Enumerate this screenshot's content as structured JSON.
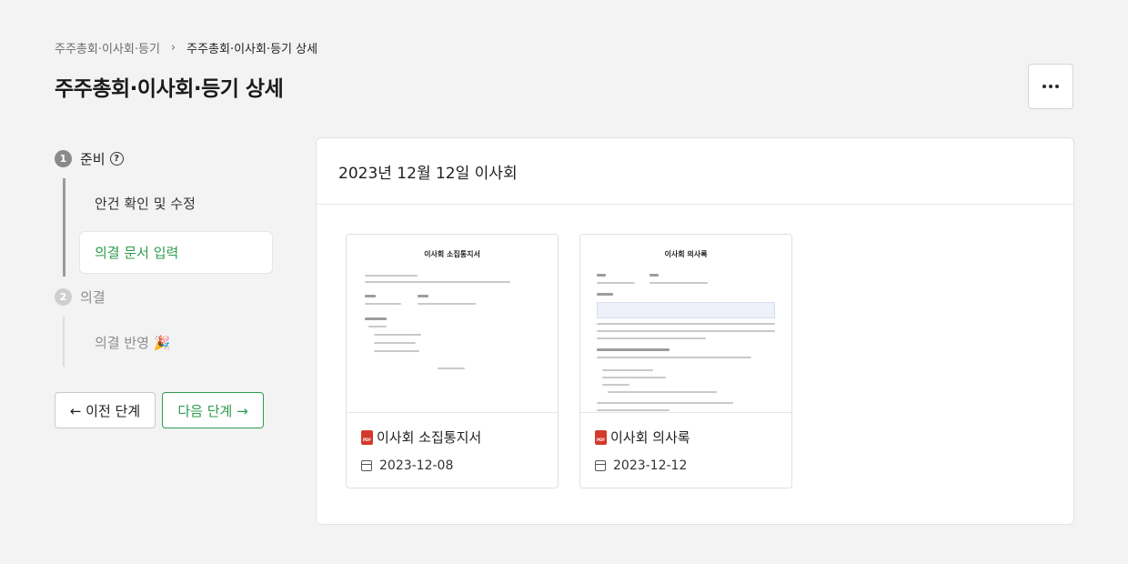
{
  "breadcrumb": {
    "parent": "주주총회·이사회·등기",
    "separator": "›",
    "current": "주주총회·이사회·등기 상세"
  },
  "page": {
    "title": "주주총회·이사회·등기 상세",
    "more_button": "more-horizontal-icon"
  },
  "stepper": {
    "step1": {
      "number": "1",
      "label": "준비",
      "help": "?"
    },
    "step1_items": [
      "안건 확인 및 수정",
      "의결 문서 입력"
    ],
    "step2": {
      "number": "2",
      "label": "의결"
    },
    "step2_items": [
      "의결 반영 🎉"
    ]
  },
  "nav": {
    "prev_label": "← 이전 단계",
    "next_label": "다음 단계 →"
  },
  "meeting": {
    "title": "2023년 12월 12일 이사회"
  },
  "documents": [
    {
      "thumb_title": "이사회 소집통지서",
      "name": "이사회 소집통지서",
      "date": "2023-12-08",
      "icon": "pdf-icon"
    },
    {
      "thumb_title": "이사회 의사록",
      "name": "이사회 의사록",
      "date": "2023-12-12",
      "icon": "pdf-icon"
    }
  ],
  "colors": {
    "accent": "#2d9c4e",
    "background": "#f3f3f4",
    "pdf": "#d33a2c"
  }
}
